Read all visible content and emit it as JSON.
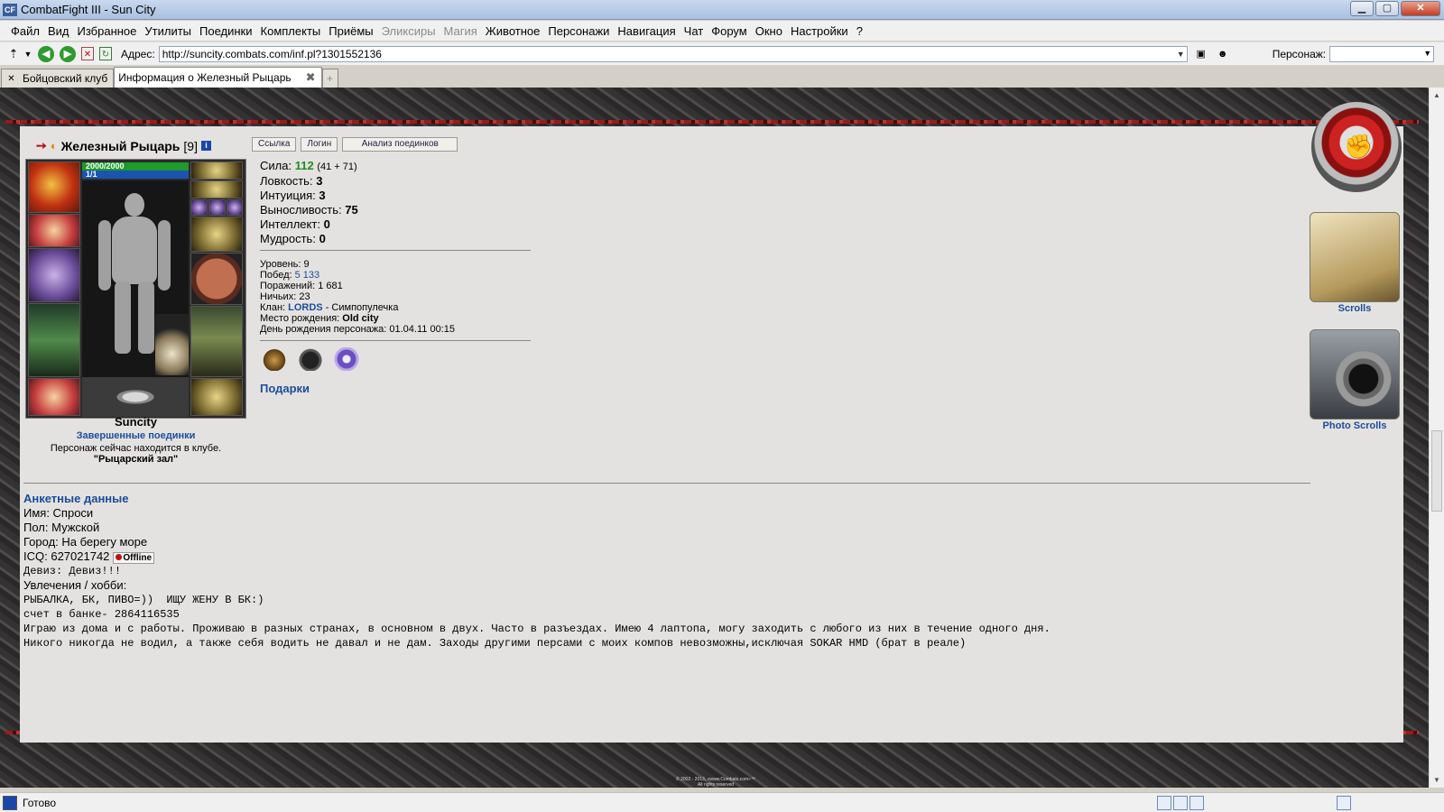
{
  "window": {
    "app_icon": "CF",
    "title": "CombatFight III - Sun City",
    "buttons": [
      "minimize",
      "maximize",
      "close"
    ]
  },
  "menu": [
    {
      "label": "Файл",
      "disabled": false
    },
    {
      "label": "Вид",
      "disabled": false
    },
    {
      "label": "Избранное",
      "disabled": false
    },
    {
      "label": "Утилиты",
      "disabled": false
    },
    {
      "label": "Поединки",
      "disabled": false
    },
    {
      "label": "Комплекты",
      "disabled": false
    },
    {
      "label": "Приёмы",
      "disabled": false
    },
    {
      "label": "Эликсиры",
      "disabled": true
    },
    {
      "label": "Магия",
      "disabled": true
    },
    {
      "label": "Животное",
      "disabled": false
    },
    {
      "label": "Персонажи",
      "disabled": false
    },
    {
      "label": "Навигация",
      "disabled": false
    },
    {
      "label": "Чат",
      "disabled": false
    },
    {
      "label": "Форум",
      "disabled": false
    },
    {
      "label": "Окно",
      "disabled": false
    },
    {
      "label": "Настройки",
      "disabled": false
    },
    {
      "label": "?",
      "disabled": false
    }
  ],
  "address": {
    "label": "Адрес:",
    "url": "http://suncity.combats.com/inf.pl?1301552136",
    "character_label": "Персонаж:",
    "character_value": ""
  },
  "tabs": [
    {
      "label": "Бойцовский клуб",
      "active": false
    },
    {
      "label": "Информация о Железный Рыцарь",
      "active": true
    }
  ],
  "character": {
    "name": "Железный Рыцарь",
    "level": "[9]",
    "hp": "2000/2000",
    "mana": "1/1",
    "buttons": [
      "Ссылка",
      "Логин",
      "Анализ поединков"
    ],
    "city": "Suncity",
    "finished_fights": "Завершенные поединки",
    "location_text": "Персонаж сейчас находится в клубе.",
    "room": "\"Рыцарский зал\""
  },
  "stats": {
    "strength_label": "Сила:",
    "strength": "112",
    "strength_detail": "(41 + 71)",
    "agility_label": "Ловкость:",
    "agility": "3",
    "intuition_label": "Интуиция:",
    "intuition": "3",
    "endurance_label": "Выносливость:",
    "endurance": "75",
    "intellect_label": "Интеллект:",
    "intellect": "0",
    "wisdom_label": "Мудрость:",
    "wisdom": "0"
  },
  "info": {
    "level_label": "Уровень:",
    "level": "9",
    "wins_label": "Побед:",
    "wins": "5 133",
    "losses_label": "Поражений:",
    "losses": "1 681",
    "draws_label": "Ничьих:",
    "draws": "23",
    "clan_label": "Клан:",
    "clan": "LORDS",
    "clan_suffix": "- Симпопулечка",
    "birthplace_label": "Место рождения:",
    "birthplace": "Old city",
    "birthday_label": "День рождения персонажа:",
    "birthday": "01.04.11 00:15"
  },
  "gifts_label": "Подарки",
  "side": {
    "scrolls_label": "Scrolls",
    "photo_label": "Photo Scrolls"
  },
  "profile": {
    "title": "Анкетные данные",
    "name_line": "Имя: Спроси",
    "gender_line": "Пол: Мужской",
    "city_line": "Город: На берегу море",
    "icq_line": "ICQ: 627021742",
    "icq_status": "Offline",
    "motto_line": "Девиз: Девиз!!!",
    "hobby_label": "Увлечения / хобби:",
    "hobby_1": "РЫБАЛКА, БК, ПИВО=))  ИЩУ ЖЕНУ В БК:)",
    "hobby_2": "счет в банке- 2864116535",
    "hobby_3": "Играю из дома и с работы. Проживаю в разных странах, в основном в двух. Часто в разъездах. Имею 4 лаптопа, могу заходить с любого из них в течение одного дня.",
    "hobby_4": "Никого никогда не водил, а также себя водить не давал и не дам. Заходы другими персами с моих компов невозможны,исключая SOKAR HMD (брат в реале)"
  },
  "footer": {
    "copyright_1": "© 2002 - 2013, «www.Combats.com»™",
    "copyright_2": "All rights reserved"
  },
  "status": {
    "text": "Готово"
  }
}
